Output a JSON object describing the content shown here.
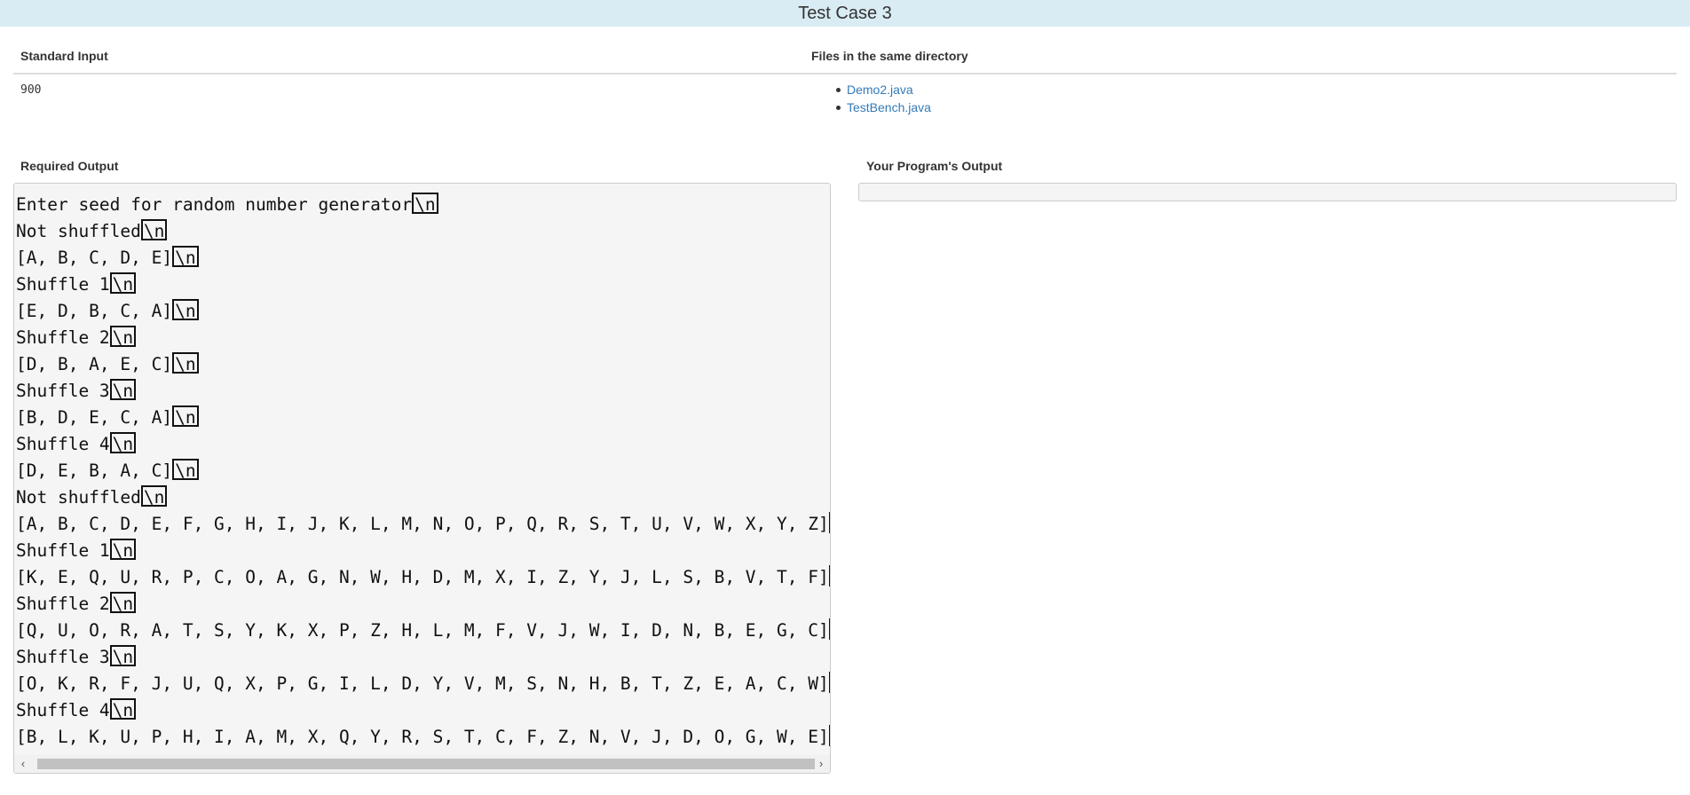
{
  "title": "Test Case 3",
  "standard_input": {
    "label": "Standard Input",
    "value": "900"
  },
  "files": {
    "label": "Files in the same directory",
    "items": [
      "Demo2.java",
      "TestBench.java"
    ]
  },
  "required_output": {
    "label": "Required Output",
    "newline_marker": "\\n",
    "lines": [
      "Enter seed for random number generator",
      "Not shuffled",
      "[A, B, C, D, E]",
      "Shuffle 1",
      "[E, D, B, C, A]",
      "Shuffle 2",
      "[D, B, A, E, C]",
      "Shuffle 3",
      "[B, D, E, C, A]",
      "Shuffle 4",
      "[D, E, B, A, C]",
      "Not shuffled",
      "[A, B, C, D, E, F, G, H, I, J, K, L, M, N, O, P, Q, R, S, T, U, V, W, X, Y, Z]",
      "Shuffle 1",
      "[K, E, Q, U, R, P, C, O, A, G, N, W, H, D, M, X, I, Z, Y, J, L, S, B, V, T, F]",
      "Shuffle 2",
      "[Q, U, O, R, A, T, S, Y, K, X, P, Z, H, L, M, F, V, J, W, I, D, N, B, E, G, C]",
      "Shuffle 3",
      "[O, K, R, F, J, U, Q, X, P, G, I, L, D, Y, V, M, S, N, H, B, T, Z, E, A, C, W]",
      "Shuffle 4",
      "[B, L, K, U, P, H, I, A, M, X, Q, Y, R, S, T, C, F, Z, N, V, J, D, O, G, W, E]"
    ]
  },
  "program_output": {
    "label": "Your Program's Output",
    "value": ""
  },
  "scrollbar": {
    "left_icon": "chevron-left-icon",
    "right_icon": "chevron-right-icon"
  }
}
